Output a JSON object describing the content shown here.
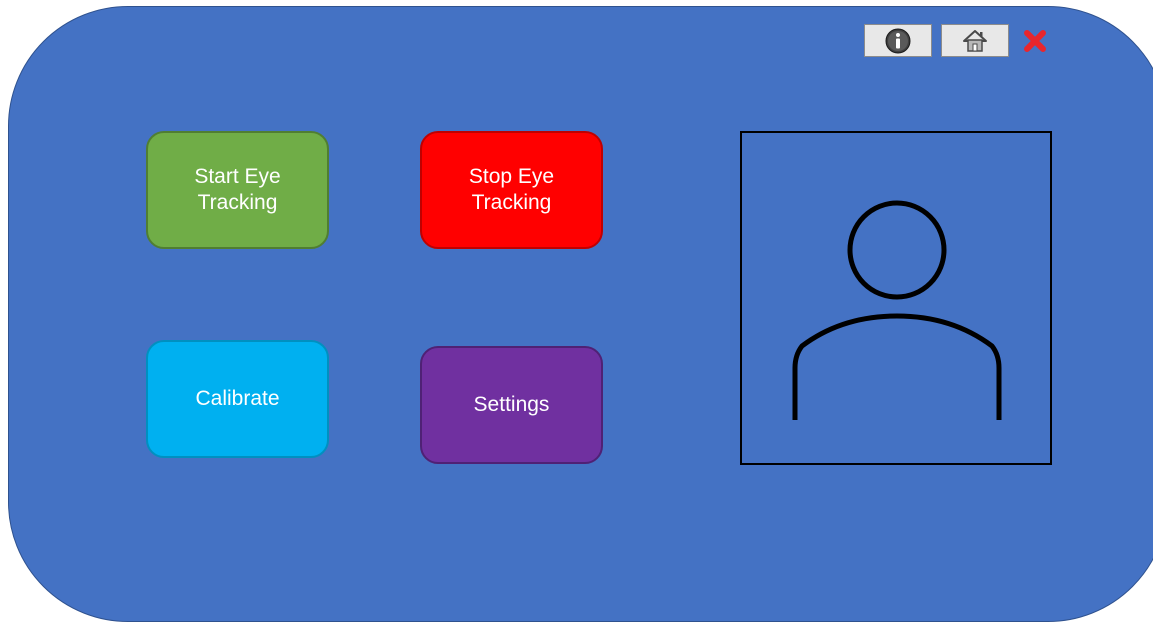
{
  "colors": {
    "panel": "#4472c4",
    "start_button": "#70ad47",
    "stop_button": "#ff0000",
    "calibrate_button": "#00b0f0",
    "settings_button": "#7030a0",
    "close_icon": "#e8262d"
  },
  "toolbar": {
    "info_icon": "info-icon",
    "home_icon": "home-icon",
    "close_icon": "close-icon"
  },
  "actions": {
    "start_label": "Start Eye\nTracking",
    "stop_label": "Stop Eye\nTracking",
    "calibrate_label": "Calibrate",
    "settings_label": "Settings"
  },
  "camera": {
    "icon": "user-avatar-icon"
  }
}
